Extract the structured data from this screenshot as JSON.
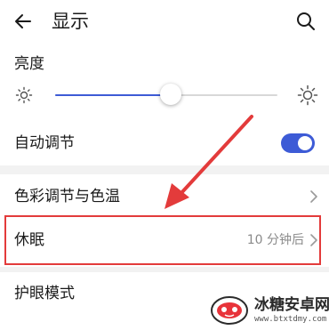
{
  "header": {
    "title": "显示",
    "back_icon": "arrow-left-icon",
    "search_icon": "search-icon"
  },
  "brightness": {
    "label": "亮度",
    "level": 0.52,
    "min_icon": "sun-small-icon",
    "max_icon": "sun-large-icon"
  },
  "auto_adjust": {
    "label": "自动调节",
    "enabled": true
  },
  "color_temperature": {
    "label": "色彩调节与色温"
  },
  "sleep": {
    "label": "休眠",
    "value": "10 分钟后"
  },
  "eye_comfort": {
    "label": "护眼模式"
  },
  "watermark": {
    "name": "冰糖安卓网",
    "url": "www.btxtdmy.com"
  },
  "colors": {
    "accent": "#3d5bd6",
    "highlight": "#e33b3b",
    "divider": "#f2f2f2"
  }
}
